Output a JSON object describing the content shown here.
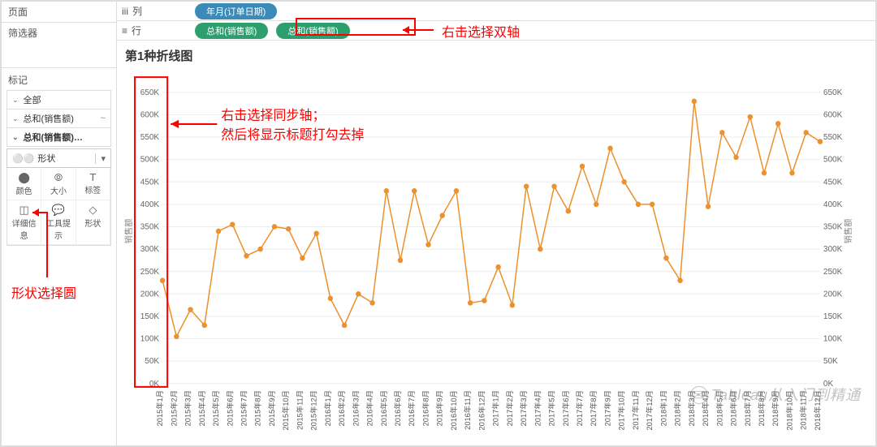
{
  "sidebar": {
    "pages_label": "页面",
    "filters_label": "筛选器",
    "marks_label": "标记",
    "mark_rows": [
      {
        "label": "全部"
      },
      {
        "label": "总和(销售额)",
        "extra": "~"
      },
      {
        "label": "总和(销售额)…"
      }
    ],
    "shape_select_icon": "⚪⚪",
    "shape_select_label": "形状",
    "mark_cells": [
      {
        "icon": "⬤",
        "label": "颜色"
      },
      {
        "icon": "⦾",
        "label": "大小"
      },
      {
        "icon": "T",
        "label": "标签"
      },
      {
        "icon": "◫",
        "label": "详细信息"
      },
      {
        "icon": "💬",
        "label": "工具提示"
      },
      {
        "icon": "◇",
        "label": "形状"
      }
    ]
  },
  "shelves": {
    "columns_icon": "iii",
    "columns_label": "列",
    "columns_pill": "年月(订单日期)",
    "rows_icon": "≡",
    "rows_label": "行",
    "rows_pill1": "总和(销售额)",
    "rows_pill2": "总和(销售额)"
  },
  "chart_title": "第1种折线图",
  "annotations": {
    "top": "右击选择双轴",
    "mid_line1": "右击选择同步轴；",
    "mid_line2": "然后将显示标题打勾去掉",
    "side": "形状选择圆"
  },
  "watermark": "Tableau从入门到精通",
  "axis_title_left": "销售额",
  "axis_title_right": "销售额",
  "chart_data": {
    "type": "line",
    "ylabel_left": "销售额",
    "ylabel_right": "销售额",
    "ylim": [
      0,
      680000
    ],
    "y_ticks": [
      "0K",
      "50K",
      "100K",
      "150K",
      "200K",
      "250K",
      "300K",
      "350K",
      "400K",
      "450K",
      "500K",
      "550K",
      "600K",
      "650K"
    ],
    "categories": [
      "2015年1月",
      "2015年2月",
      "2015年3月",
      "2015年4月",
      "2015年5月",
      "2015年6月",
      "2015年7月",
      "2015年8月",
      "2015年9月",
      "2015年10月",
      "2015年11月",
      "2015年12月",
      "2016年1月",
      "2016年2月",
      "2016年3月",
      "2016年4月",
      "2016年5月",
      "2016年6月",
      "2016年7月",
      "2016年8月",
      "2016年9月",
      "2016年10月",
      "2016年11月",
      "2016年12月",
      "2017年1月",
      "2017年2月",
      "2017年3月",
      "2017年4月",
      "2017年5月",
      "2017年6月",
      "2017年7月",
      "2017年8月",
      "2017年9月",
      "2017年10月",
      "2017年11月",
      "2017年12月",
      "2018年1月",
      "2018年2月",
      "2018年3月",
      "2018年4月",
      "2018年5月",
      "2018年6月",
      "2018年7月",
      "2018年8月",
      "2018年9月",
      "2018年10月",
      "2018年11月",
      "2018年12月"
    ],
    "series": [
      {
        "name": "销售额",
        "values": [
          230000,
          105000,
          165000,
          130000,
          340000,
          355000,
          285000,
          300000,
          350000,
          345000,
          280000,
          335000,
          190000,
          130000,
          200000,
          180000,
          430000,
          275000,
          430000,
          310000,
          375000,
          430000,
          180000,
          185000,
          260000,
          175000,
          440000,
          300000,
          440000,
          385000,
          485000,
          400000,
          525000,
          450000,
          400000,
          400000,
          280000,
          230000,
          630000,
          395000,
          560000,
          505000,
          595000,
          470000,
          580000,
          470000,
          560000,
          540000
        ]
      }
    ]
  }
}
